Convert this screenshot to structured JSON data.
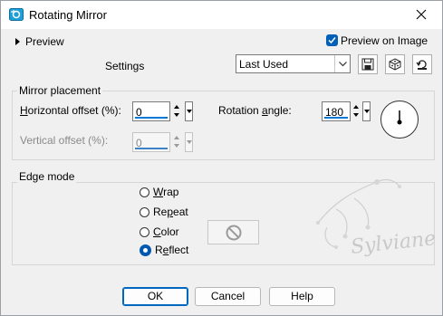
{
  "window": {
    "title": "Rotating Mirror",
    "icon": "rotating-mirror-app-icon"
  },
  "titlebar": {
    "close_icon": "close-icon"
  },
  "preview": {
    "toggle_label": "Preview",
    "preview_on_image_label": "Preview on Image",
    "preview_on_image_checked": true
  },
  "settings": {
    "label": "Settings",
    "preset_value": "Last Used",
    "tools": [
      "save-preset-icon",
      "randomize-icon",
      "reset-icon"
    ]
  },
  "mirror_placement": {
    "title": "Mirror placement",
    "horizontal_label_prefix": "",
    "horizontal_label_u": "H",
    "horizontal_label_rest": "orizontal offset (%):",
    "horizontal_value": "0",
    "vertical_label": "Vertical offset (%):",
    "vertical_value": "0",
    "vertical_enabled": false,
    "rotation_label_pre": "Rotation ",
    "rotation_label_u": "a",
    "rotation_label_rest": "ngle:",
    "rotation_value": "180"
  },
  "edge_mode": {
    "title": "Edge mode",
    "options": [
      {
        "pre": "",
        "u": "W",
        "rest": "rap",
        "selected": false
      },
      {
        "pre": "Re",
        "u": "p",
        "rest": "eat",
        "selected": false
      },
      {
        "pre": "",
        "u": "C",
        "rest": "olor",
        "selected": false
      },
      {
        "pre": "R",
        "u": "e",
        "rest": "flect",
        "selected": true
      }
    ],
    "color_swatch_icon": "disabled-circle-icon"
  },
  "watermark": {
    "text": "Sylviane"
  },
  "buttons": {
    "ok": "OK",
    "cancel": "Cancel",
    "help": "Help"
  },
  "colors": {
    "accent": "#0067c0",
    "dialog_bg": "#f0f0f0"
  }
}
